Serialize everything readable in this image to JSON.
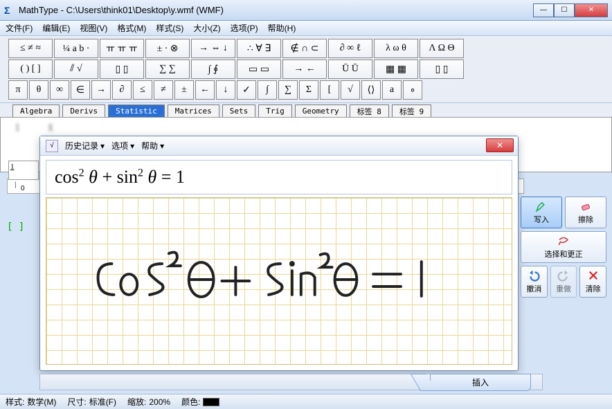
{
  "window": {
    "title": "MathType - C:\\Users\\think01\\Desktop\\y.wmf (WMF)"
  },
  "menu": {
    "file": "文件(F)",
    "edit": "编辑(E)",
    "view": "视图(V)",
    "format": "格式(M)",
    "style": "样式(S)",
    "size": "大小(Z)",
    "options": "选项(P)",
    "help": "帮助(H)"
  },
  "toolrows": {
    "r1": [
      "≤ ≠ ≈",
      "¼ a b ⋅",
      "ￗ ￗ ￗ",
      "± ⋅ ⊗",
      "→ ⇔ ↓",
      "∴ ∀ ∃",
      "∉ ∩ ⊂",
      "∂ ∞ ℓ",
      "λ ω θ",
      "Λ Ω Θ"
    ],
    "r2": [
      "( ) [ ]",
      "⫽ √",
      "▯ ▯",
      "∑ ∑",
      "∫ ∮",
      "▭ ▭",
      "→ ←",
      "Ū Ū",
      "▦ ▦",
      "▯ ▯"
    ],
    "r3": [
      "π",
      "θ",
      "∞",
      "∈",
      "→",
      "∂",
      "≤",
      "≠",
      "±",
      "←",
      "↓",
      "✓",
      "∫",
      "∑",
      "Σ",
      "[",
      "√",
      "⟨⟩",
      "a",
      "∘"
    ]
  },
  "tabs": [
    "Algebra",
    "Derivs",
    "Statistic",
    "Matrices",
    "Sets",
    "Trig",
    "Geometry",
    "标签 8",
    "标签 9"
  ],
  "active_tab_index": 2,
  "handwriting": {
    "menu_history": "历史记录",
    "menu_options": "选项",
    "menu_help": "帮助",
    "recognized": "cos² θ + sin² θ = 1"
  },
  "sidebtns": {
    "write": "写入",
    "erase": "擦除",
    "select_correct": "选择和更正",
    "undo": "撤消",
    "redo": "重做",
    "clear": "清除"
  },
  "insert_label": "插入",
  "statusbar": {
    "style_label": "样式:",
    "style_value": "数学(M)",
    "size_label": "尺寸:",
    "size_value": "标准(F)",
    "zoom_label": "缩放:",
    "zoom_value": "200%",
    "color_label": "颜色:"
  },
  "ruler_marker": "0",
  "left_fraction": "1"
}
